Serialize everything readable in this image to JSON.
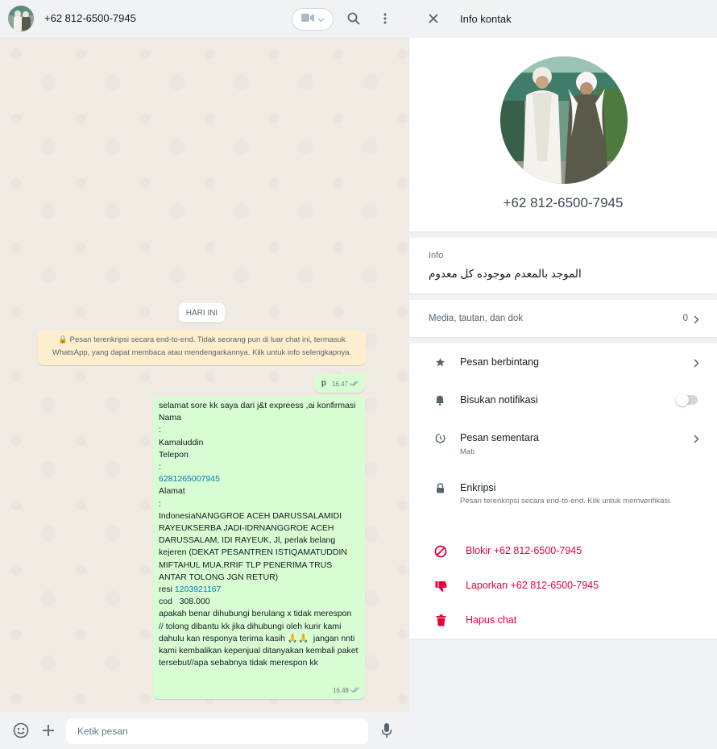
{
  "chat": {
    "contact_name": "+62 812-6500-7945",
    "day_label": "HARI INI",
    "e2e_notice": "🔒 Pesan terenkripsi secara end-to-end. Tidak seorang pun di luar chat ini, termasuk WhatsApp, yang dapat membaca atau mendengarkannya. Klik untuk info selengkapnya.",
    "messages": [
      {
        "text": "p",
        "time": "16.47"
      },
      {
        "text_before_phone": "selamat sore kk saya dari j&t expreess ,ai konfirmasi\nNama\n:\nKamaluddin\nTelepon\n:\n",
        "phone_link": "6281265007945",
        "text_middle": "\nAlamat\n:\nIndonesiaNANGGROE ACEH DARUSSALAMIDI RAYEUKSERBA JADI-IDRNANGGROE ACEH DARUSSALAM, IDI RAYEUK, Jl, perlak belang kejeren (DEKAT PESANTREN ISTIQAMATUDDIN MIFTAHUL MUA,RRIF TLP PENERIMA TRUS ANTAR TOLONG JGN RETUR)\nresi ",
        "resi_link": "1203921167",
        "text_after": "\ncod   308.000\napakah benar dihubungi berulang x tidak merespon  // tolong dibantu kk jika dihubungi oleh kurir kami dahulu kan responya terima kasih 🙏🙏  jangan nnti kami kembalikan kepenjual ditanyakan kembali paket tersebut//apa sebabnya tidak merespon kk",
        "time": "16.48"
      }
    ],
    "compose_placeholder": "Ketik pesan"
  },
  "info": {
    "header_title": "Info kontak",
    "phone": "+62 812-6500-7945",
    "about_label": "Info",
    "about_text": "الموجد بالمعدم موجوده كل معدوم",
    "media_label": "Media, tautan, dan dok",
    "media_count": "0",
    "starred_label": "Pesan berbintang",
    "mute_label": "Bisukan notifikasi",
    "mute_on": false,
    "disappearing_label": "Pesan sementara",
    "disappearing_value": "Mati",
    "encryption_label": "Enkripsi",
    "encryption_desc": "Pesan terenkripsi secara end-to-end. Klik untuk memverifikasi.",
    "block_label": "Blokir +62 812-6500-7945",
    "report_label": "Laporkan +62 812-6500-7945",
    "delete_label": "Hapus chat"
  },
  "colors": {
    "accent_danger": "#ea0038",
    "bubble_out": "#d9fdd3",
    "notice_bg": "#ffeecd",
    "link": "#027eb5"
  },
  "icons": [
    "video-call-icon",
    "search-icon",
    "menu-dots-icon",
    "emoji-icon",
    "attach-plus-icon",
    "mic-icon",
    "close-icon",
    "star-icon",
    "bell-icon",
    "timer-icon",
    "lock-icon",
    "block-icon",
    "thumbs-down-icon",
    "trash-icon",
    "chevron-right-icon",
    "double-check-icon"
  ]
}
